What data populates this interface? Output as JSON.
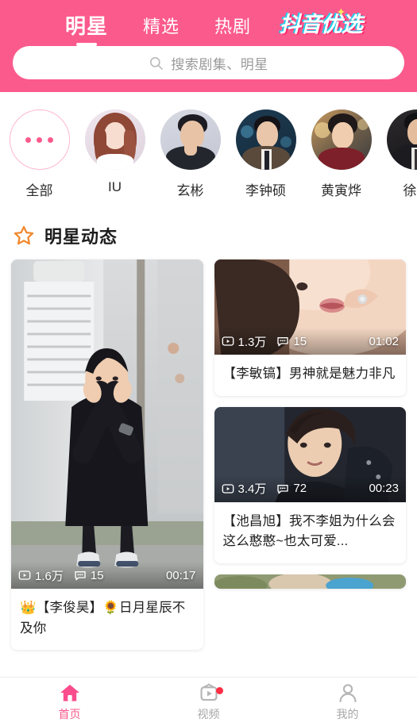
{
  "header": {
    "background_color": "#fb5a8c",
    "tabs": [
      {
        "label": "明星",
        "active": true
      },
      {
        "label": "精选",
        "active": false
      },
      {
        "label": "热剧",
        "active": false
      }
    ],
    "brand_logo": "抖音优选",
    "search": {
      "placeholder": "搜索剧集、明星",
      "icon": "search-icon"
    }
  },
  "stars": {
    "items": [
      {
        "name": "全部",
        "type": "all"
      },
      {
        "name": "IU",
        "type": "photo"
      },
      {
        "name": "玄彬",
        "type": "photo"
      },
      {
        "name": "李钟硕",
        "type": "photo"
      },
      {
        "name": "黄寅烨",
        "type": "photo"
      },
      {
        "name": "徐仁",
        "type": "photo"
      }
    ]
  },
  "section": {
    "icon": "star-outline-icon",
    "icon_color": "#f2872b",
    "title": "明星动态"
  },
  "feed": {
    "left_column": [
      {
        "plays": "1.6万",
        "comments": "15",
        "duration": "00:17",
        "title": "👑【李俊昊】🌻日月星辰不及你",
        "emoji_lead": "👑",
        "emoji_mid": "🌻"
      }
    ],
    "right_column": [
      {
        "plays": "1.3万",
        "comments": "15",
        "duration": "01:02",
        "title": "【李敏镐】男神就是魅力非凡"
      },
      {
        "plays": "3.4万",
        "comments": "72",
        "duration": "00:23",
        "title": "【池昌旭】我不李姐为什么会这么憨憨~也太可爱..."
      }
    ],
    "icons": {
      "plays": "play-icon",
      "comments": "comment-icon"
    }
  },
  "bottom_nav": {
    "active_color": "#fb5a8c",
    "inactive_color": "#a8a8a8",
    "items": [
      {
        "label": "首页",
        "icon": "home-icon",
        "active": true,
        "badge": false
      },
      {
        "label": "视频",
        "icon": "tv-play-icon",
        "active": false,
        "badge": true
      },
      {
        "label": "我的",
        "icon": "person-icon",
        "active": false,
        "badge": false
      }
    ]
  }
}
